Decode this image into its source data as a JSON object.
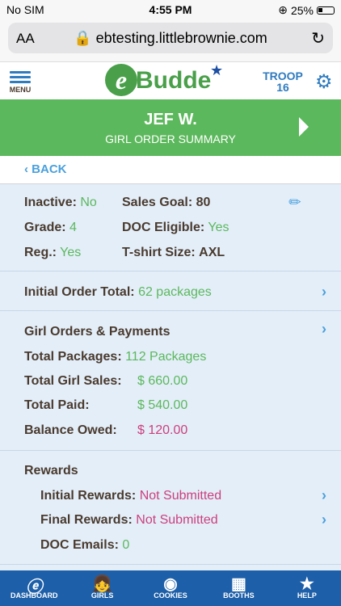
{
  "status": {
    "carrier": "No SIM",
    "time": "4:55 PM",
    "battery": "25%"
  },
  "browser": {
    "aa": "AA",
    "url": "ebtesting.littlebrownie.com"
  },
  "header": {
    "menu_label": "MENU",
    "logo_text": "Budde",
    "troop_label": "TROOP",
    "troop_number": "16"
  },
  "banner": {
    "name": "JEF W.",
    "subtitle": "GIRL ORDER SUMMARY"
  },
  "back_label": "BACK",
  "info": {
    "inactive_label": "Inactive:",
    "inactive_value": "No",
    "sales_goal_label": "Sales Goal:",
    "sales_goal_value": "80",
    "grade_label": "Grade:",
    "grade_value": "4",
    "doc_eligible_label": "DOC Eligible:",
    "doc_eligible_value": "Yes",
    "reg_label": "Reg.:",
    "reg_value": "Yes",
    "tshirt_label": "T-shirt Size:",
    "tshirt_value": "AXL"
  },
  "initial_order": {
    "label": "Initial Order Total:",
    "value": "62 packages"
  },
  "orders": {
    "title": "Girl Orders & Payments",
    "total_packages_label": "Total Packages:",
    "total_packages_value": "112 Packages",
    "total_sales_label": "Total Girl Sales:",
    "total_sales_value": "$ 660.00",
    "total_paid_label": "Total Paid:",
    "total_paid_value": "$ 540.00",
    "balance_label": "Balance Owed:",
    "balance_value": "$ 120.00"
  },
  "rewards": {
    "title": "Rewards",
    "initial_label": "Initial Rewards:",
    "initial_value": "Not Submitted",
    "final_label": "Final Rewards:",
    "final_value": "Not Submitted",
    "doc_emails_label": "DOC Emails:",
    "doc_emails_value": "0"
  },
  "tabs": [
    {
      "label": "DASHBOARD",
      "icon": "e-icon"
    },
    {
      "label": "GIRLS",
      "icon": "girl-icon"
    },
    {
      "label": "COOKIES",
      "icon": "cookie-icon"
    },
    {
      "label": "BOOTHS",
      "icon": "booth-icon"
    },
    {
      "label": "HELP",
      "icon": "help-icon"
    }
  ],
  "colors": {
    "green": "#5cb85c",
    "blue": "#2f7bbf",
    "tabbar": "#1d5fa8",
    "pink": "#cc3f7e",
    "content_bg": "#e3eef9"
  }
}
